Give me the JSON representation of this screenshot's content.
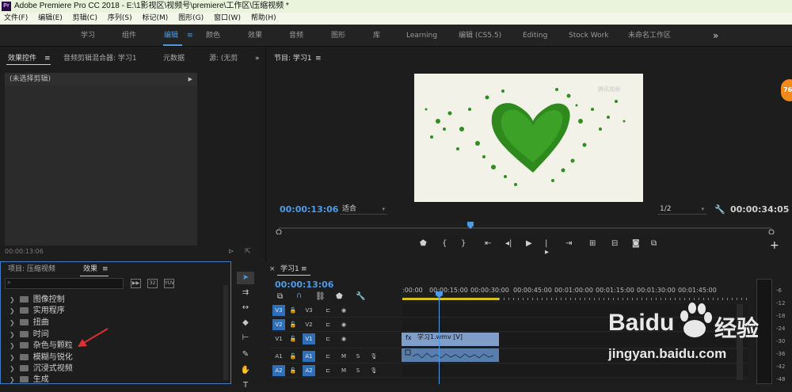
{
  "window": {
    "app_icon": "Pr",
    "title": "Adobe Premiere Pro CC 2018 - E:\\1影视区\\视频号\\premiere\\工作区\\压缩视频 *"
  },
  "menu": [
    "文件(F)",
    "编辑(E)",
    "剪辑(C)",
    "序列(S)",
    "标记(M)",
    "图形(G)",
    "窗口(W)",
    "帮助(H)"
  ],
  "workspaces": {
    "items": [
      "学习",
      "组件",
      "编辑",
      "颜色",
      "效果",
      "音频",
      "图形",
      "库",
      "Learning",
      "编辑 (CS5.5)",
      "Editing",
      "Stock Work",
      "未命名工作区"
    ],
    "active": "编辑",
    "more": "»",
    "menu_icon": "≡"
  },
  "effect_controls": {
    "tabs": [
      "效果控件",
      "音频剪辑混合器: 学习1",
      "元数据",
      "源: (无剪"
    ],
    "more": "»",
    "menu_icon": "≡",
    "no_clip": "(未选择剪辑)",
    "timecode": "00:00:13:06"
  },
  "program": {
    "title": "节目: 学习1",
    "menu_icon": "≡",
    "current_time": "00:00:13:06",
    "fit": "适合",
    "resolution": "1/2",
    "duration": "00:00:34:05",
    "watermark": "腾讯视频",
    "add": "+"
  },
  "project": {
    "tab_project": "项目: 压缩视频",
    "tab_effects": "效果",
    "menu_icon": "≡",
    "folders": [
      "图像控制",
      "实用程序",
      "扭曲",
      "时间",
      "杂色与颗粒",
      "模糊与锐化",
      "沉浸式视频",
      "生成"
    ]
  },
  "timeline": {
    "close": "×",
    "sequence_name": "学习1",
    "menu_icon": "≡",
    "current_time": "00:00:13:06",
    "ruler_labels": [
      ":00:00",
      "00:00:15:00",
      "00:00:30:00",
      "00:00:45:00",
      "00:01:00:00",
      "00:01:15:00",
      "00:01:30:00",
      "00:01:45:00"
    ],
    "video_tracks": [
      {
        "src": "V3",
        "name": "V3"
      },
      {
        "src": "V2",
        "name": "V2"
      },
      {
        "src": "V1",
        "name": "V1"
      }
    ],
    "audio_tracks": [
      {
        "src": "A1",
        "name": "A1",
        "m": "M",
        "s": "S"
      },
      {
        "src": "A2",
        "name": "A2",
        "m": "M",
        "s": "S"
      }
    ],
    "clip_label": "学习1.wmv [V]"
  },
  "meter": {
    "labels": [
      "-6",
      "-12",
      "-18",
      "-24",
      "-30",
      "-36",
      "-42",
      "-48"
    ]
  },
  "overlay": {
    "baidu": "Baidu",
    "baidu_cn": "经验",
    "baidu_url": "jingyan.baidu.com",
    "badge": "76"
  },
  "colors": {
    "accent": "#4d9be6",
    "clip": "#7f9ec9",
    "arrow": "#e03030"
  }
}
